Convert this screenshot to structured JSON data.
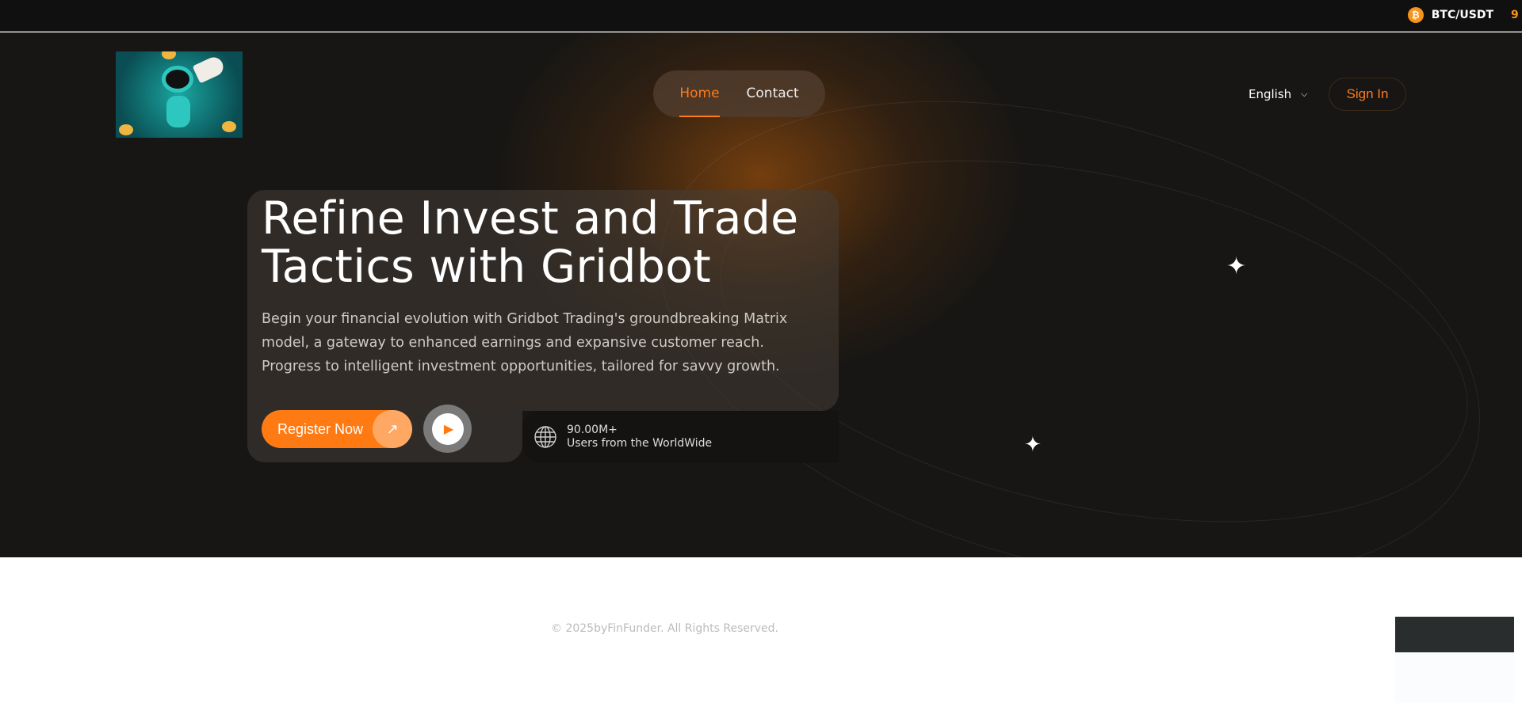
{
  "ticker": {
    "pair": "BTC/USDT",
    "value": "9",
    "icon": "bitcoin-icon"
  },
  "nav": {
    "items": [
      {
        "label": "Home",
        "active": true
      },
      {
        "label": "Contact",
        "active": false
      }
    ]
  },
  "language": {
    "selected": "English"
  },
  "signin_label": "Sign In",
  "hero": {
    "title": "Refine Invest and Trade Tactics with Gridbot",
    "description": "Begin your financial evolution with Gridbot Trading's groundbreaking Matrix model, a gateway to enhanced earnings and expansive customer reach. Progress to intelligent investment opportunities, tailored for savvy growth.",
    "register_label": "Register Now",
    "stats_value": "90.00M+",
    "stats_label": "Users from the WorldWide"
  },
  "footer": {
    "copyright": "© 2025byFinFunder. All Rights Reserved."
  },
  "colors": {
    "accent": "#ff7a12",
    "background": "#171614"
  }
}
